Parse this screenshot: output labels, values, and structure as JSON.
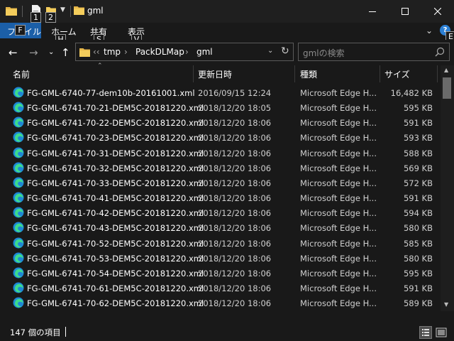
{
  "window": {
    "title": "gml",
    "minimize_icon": "minimize-icon",
    "maximize_icon": "maximize-icon",
    "close_icon": "close-icon"
  },
  "quick_access": {
    "keytip_1": "1",
    "keytip_2": "2"
  },
  "ribbon": {
    "tabs": [
      {
        "label": "ファイル",
        "keytip": "F"
      },
      {
        "label": "ホーム",
        "keytip": "H"
      },
      {
        "label": "共有",
        "keytip": "S"
      },
      {
        "label": "表示",
        "keytip": "V"
      }
    ],
    "help_label": "?",
    "help_keytip": "E",
    "accent": "#1b5fa8"
  },
  "address": {
    "overflow": "‹‹",
    "crumbs": [
      "tmp",
      "PackDLMap",
      "gml"
    ],
    "separator": "›"
  },
  "search": {
    "placeholder": "gmlの検索"
  },
  "columns": {
    "name": "名前",
    "date": "更新日時",
    "type": "種類",
    "size": "サイズ"
  },
  "files": [
    {
      "name": "FG-GML-6740-77-dem10b-20161001.xml",
      "date": "2016/09/15 12:24",
      "type": "Microsoft Edge H...",
      "size": "16,482 KB"
    },
    {
      "name": "FG-GML-6741-70-21-DEM5C-20181220.xml",
      "date": "2018/12/20 18:05",
      "type": "Microsoft Edge H...",
      "size": "595 KB"
    },
    {
      "name": "FG-GML-6741-70-22-DEM5C-20181220.xml",
      "date": "2018/12/20 18:06",
      "type": "Microsoft Edge H...",
      "size": "591 KB"
    },
    {
      "name": "FG-GML-6741-70-23-DEM5C-20181220.xml",
      "date": "2018/12/20 18:06",
      "type": "Microsoft Edge H...",
      "size": "593 KB"
    },
    {
      "name": "FG-GML-6741-70-31-DEM5C-20181220.xml",
      "date": "2018/12/20 18:06",
      "type": "Microsoft Edge H...",
      "size": "588 KB"
    },
    {
      "name": "FG-GML-6741-70-32-DEM5C-20181220.xml",
      "date": "2018/12/20 18:06",
      "type": "Microsoft Edge H...",
      "size": "569 KB"
    },
    {
      "name": "FG-GML-6741-70-33-DEM5C-20181220.xml",
      "date": "2018/12/20 18:06",
      "type": "Microsoft Edge H...",
      "size": "572 KB"
    },
    {
      "name": "FG-GML-6741-70-41-DEM5C-20181220.xml",
      "date": "2018/12/20 18:06",
      "type": "Microsoft Edge H...",
      "size": "591 KB"
    },
    {
      "name": "FG-GML-6741-70-42-DEM5C-20181220.xml",
      "date": "2018/12/20 18:06",
      "type": "Microsoft Edge H...",
      "size": "594 KB"
    },
    {
      "name": "FG-GML-6741-70-43-DEM5C-20181220.xml",
      "date": "2018/12/20 18:06",
      "type": "Microsoft Edge H...",
      "size": "580 KB"
    },
    {
      "name": "FG-GML-6741-70-52-DEM5C-20181220.xml",
      "date": "2018/12/20 18:06",
      "type": "Microsoft Edge H...",
      "size": "585 KB"
    },
    {
      "name": "FG-GML-6741-70-53-DEM5C-20181220.xml",
      "date": "2018/12/20 18:06",
      "type": "Microsoft Edge H...",
      "size": "580 KB"
    },
    {
      "name": "FG-GML-6741-70-54-DEM5C-20181220.xml",
      "date": "2018/12/20 18:06",
      "type": "Microsoft Edge H...",
      "size": "595 KB"
    },
    {
      "name": "FG-GML-6741-70-61-DEM5C-20181220.xml",
      "date": "2018/12/20 18:06",
      "type": "Microsoft Edge H...",
      "size": "591 KB"
    },
    {
      "name": "FG-GML-6741-70-62-DEM5C-20181220.xml",
      "date": "2018/12/20 18:06",
      "type": "Microsoft Edge H...",
      "size": "589 KB"
    }
  ],
  "file_icon": "edge-icon",
  "status": {
    "count": "147 個の項目"
  }
}
